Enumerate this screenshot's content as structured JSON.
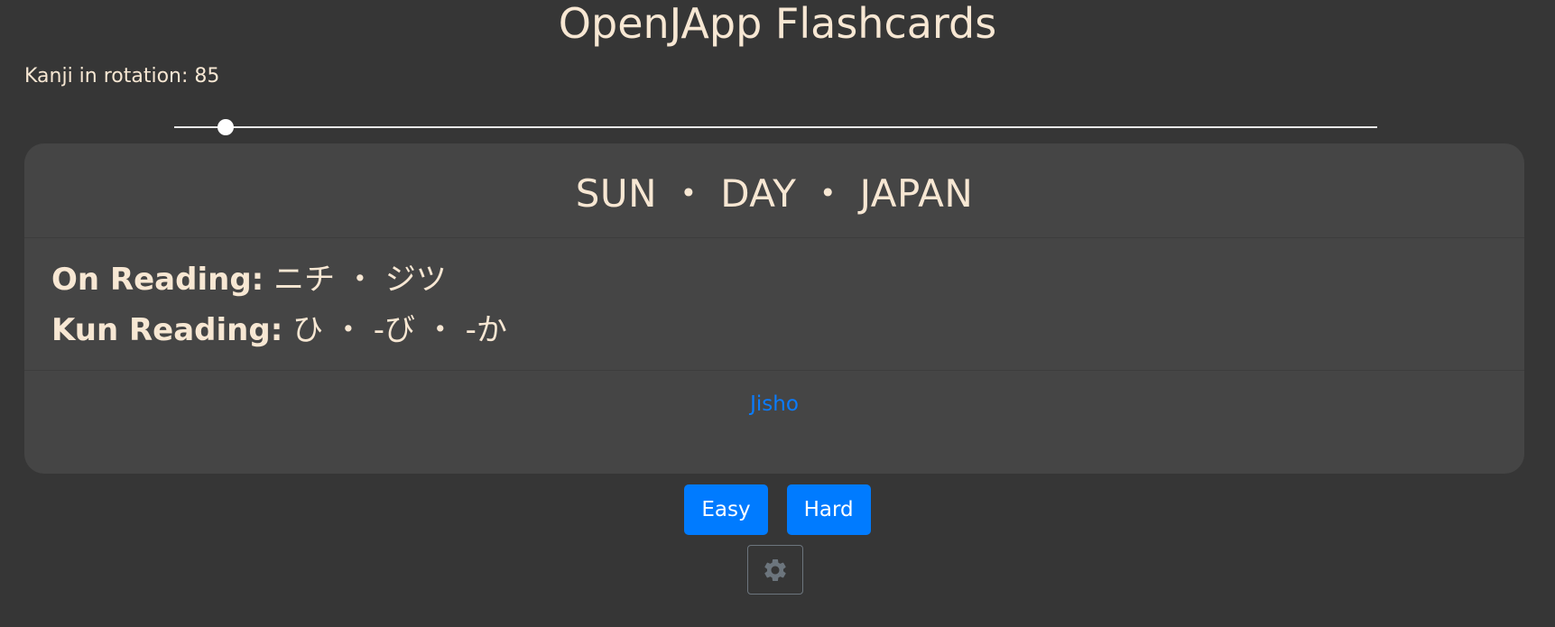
{
  "app": {
    "title": "OpenJApp Flashcards"
  },
  "rotation": {
    "label": "Kanji in rotation: 85",
    "slider_fraction": 0.043
  },
  "card": {
    "meaning": "SUN ・ DAY ・ JAPAN",
    "on_label": "On Reading:",
    "on_value": " ニチ ・ ジツ",
    "kun_label": "Kun Reading:",
    "kun_value": " ひ ・ -び ・ -か",
    "link_label": "Jisho"
  },
  "actions": {
    "easy_label": "Easy",
    "hard_label": "Hard",
    "settings_icon": "gear-icon"
  },
  "colors": {
    "background": "#363636",
    "card": "#454545",
    "text": "#f7e7d3",
    "link": "#0a7cff",
    "button": "#007bff"
  }
}
